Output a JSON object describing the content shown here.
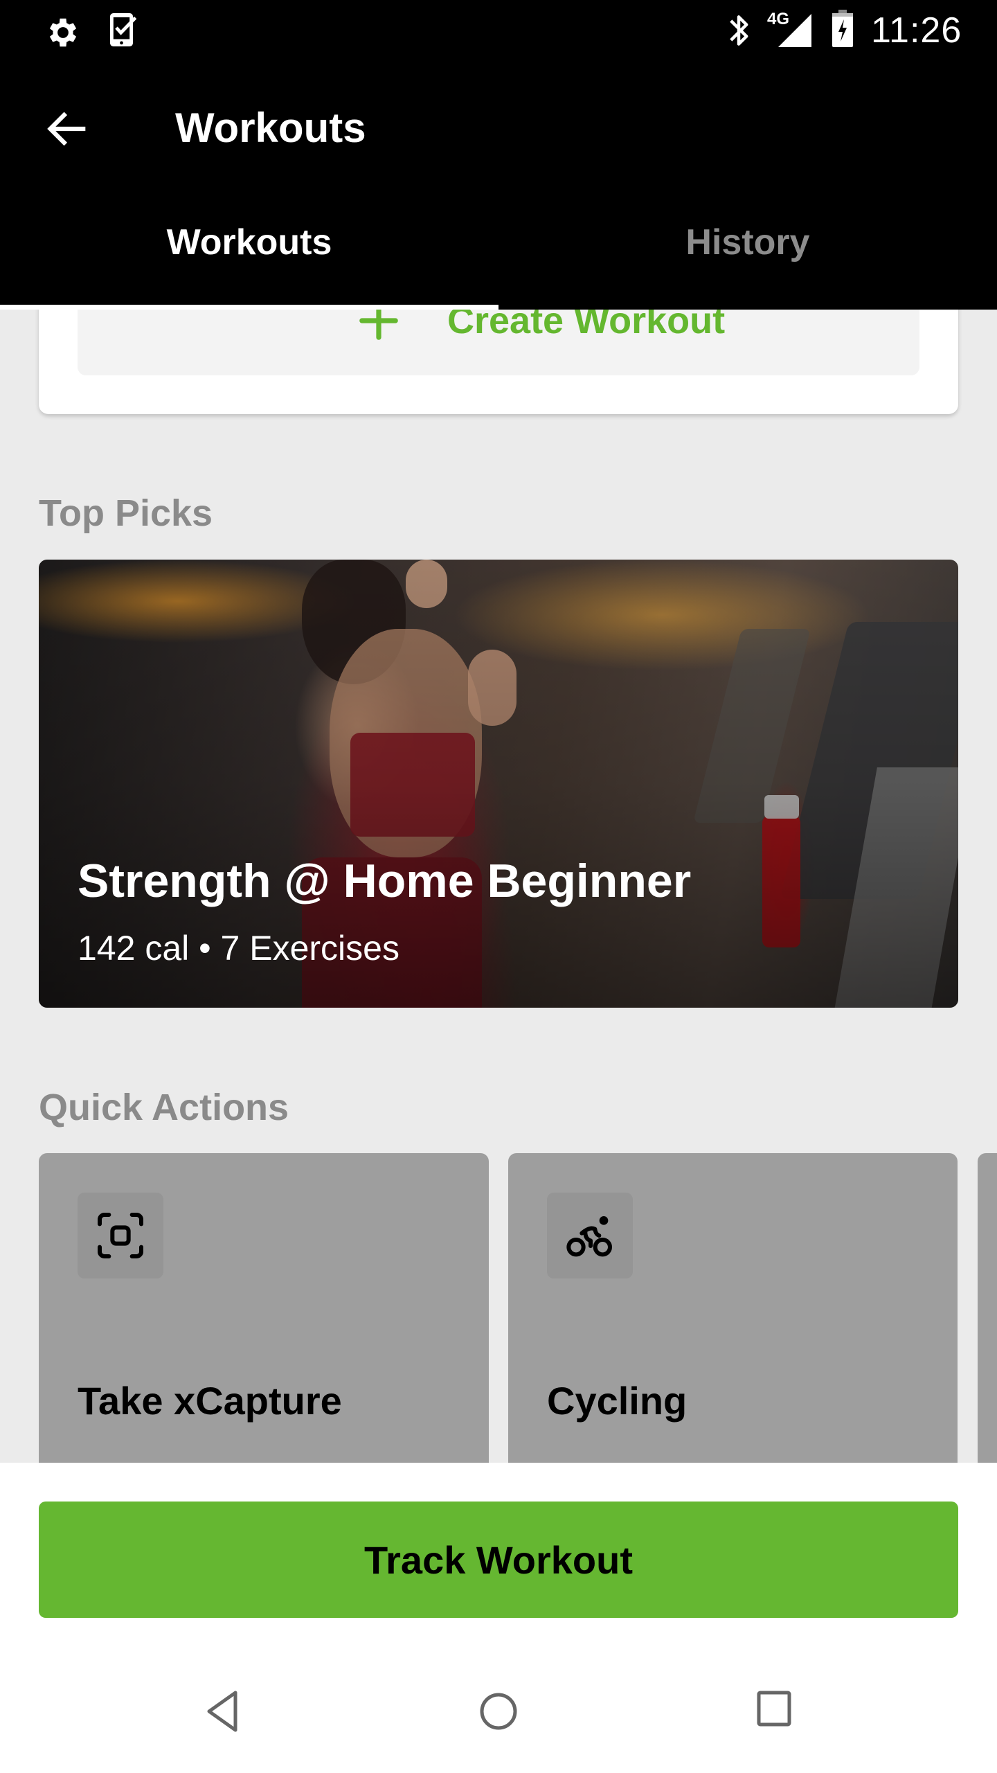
{
  "status_bar": {
    "left_icons": [
      "settings-gear-icon",
      "phone-check-icon"
    ],
    "right_icons": [
      "bluetooth-icon",
      "4g-signal-icon",
      "battery-charging-icon"
    ],
    "network_label": "4G",
    "time": "11:26"
  },
  "app_bar": {
    "back_icon": "arrow-left-icon",
    "title": "Workouts"
  },
  "tabs": {
    "active": "Workouts",
    "items": [
      {
        "label": "Workouts",
        "selected": true
      },
      {
        "label": "History",
        "selected": false
      }
    ]
  },
  "create": {
    "icon": "plus-icon",
    "label": "Create Workout"
  },
  "top_picks": {
    "section_title": "Top Picks",
    "featured": {
      "title": "Strength @ Home Beginner",
      "meta": "142 cal • 7 Exercises",
      "calories": "142 cal",
      "exercises": "7 Exercises",
      "image": "woman running on treadmill in gym"
    }
  },
  "quick_actions": {
    "section_title": "Quick Actions",
    "items": [
      {
        "label": "Take xCapture",
        "icon": "capture-frame-icon"
      },
      {
        "label": "Cycling",
        "icon": "cycling-icon"
      },
      {
        "label": "",
        "icon": ""
      }
    ]
  },
  "primary_action": {
    "label": "Track Workout"
  },
  "nav_bar": {
    "items": [
      "back-nav-icon",
      "home-nav-icon",
      "recents-nav-icon"
    ]
  },
  "colors": {
    "accent_green": "#65b731",
    "toolbar_bg": "#000000",
    "page_bg": "#ebebeb",
    "inactive_tab": "#8c8c8c",
    "quick_action_card": "#9e9e9e"
  }
}
